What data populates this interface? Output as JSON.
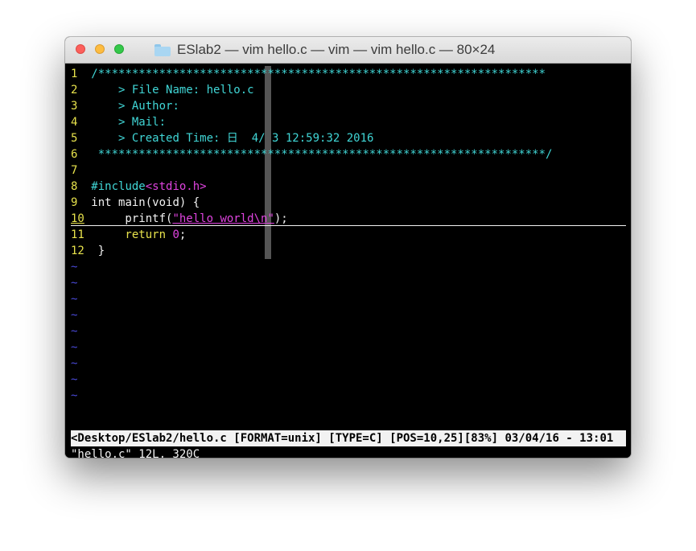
{
  "window": {
    "title": "ESlab2 — vim hello.c — vim — vim hello.c — 80×24",
    "folder_icon": "folder-icon",
    "buttons": {
      "close": "close",
      "minimize": "minimize",
      "maximize": "maximize"
    },
    "colors": {
      "close": "#fc605c",
      "minimize": "#fdbc40",
      "maximize": "#34c84a"
    }
  },
  "editor": {
    "colors": {
      "line_number": "#e7e24c",
      "comment": "#40d6d6",
      "preproc_string": "#e044e0",
      "text": "#f2f2f2",
      "tilde": "#4a4ad8"
    },
    "lines": [
      {
        "num": "1",
        "code": "/******************************************************************"
      },
      {
        "num": "2",
        "code": "    > File Name: hello.c"
      },
      {
        "num": "3",
        "code": "    > Author:"
      },
      {
        "num": "4",
        "code": "    > Mail:"
      },
      {
        "num": "5",
        "code": "    > Created Time: 日  4/ 3 12:59:32 2016"
      },
      {
        "num": "6",
        "code": " ******************************************************************/"
      },
      {
        "num": "7",
        "code": ""
      },
      {
        "num": "8",
        "kw": "#include",
        "str": "<stdio.h>"
      },
      {
        "num": "9",
        "code": "int main(void) {"
      },
      {
        "num": "10",
        "pre": "    printf(",
        "str": "\"hello world\\n\"",
        "post": ");"
      },
      {
        "num": "11",
        "kw": "    return ",
        "str": "0",
        "post": ";"
      },
      {
        "num": "12",
        "code": "}"
      }
    ],
    "tilde": "~",
    "status_line": "<Desktop/ESlab2/hello.c [FORMAT=unix] [TYPE=C] [POS=10,25][83%] 03/04/16 - 13:01",
    "message": "\"hello.c\" 12L, 320C"
  }
}
